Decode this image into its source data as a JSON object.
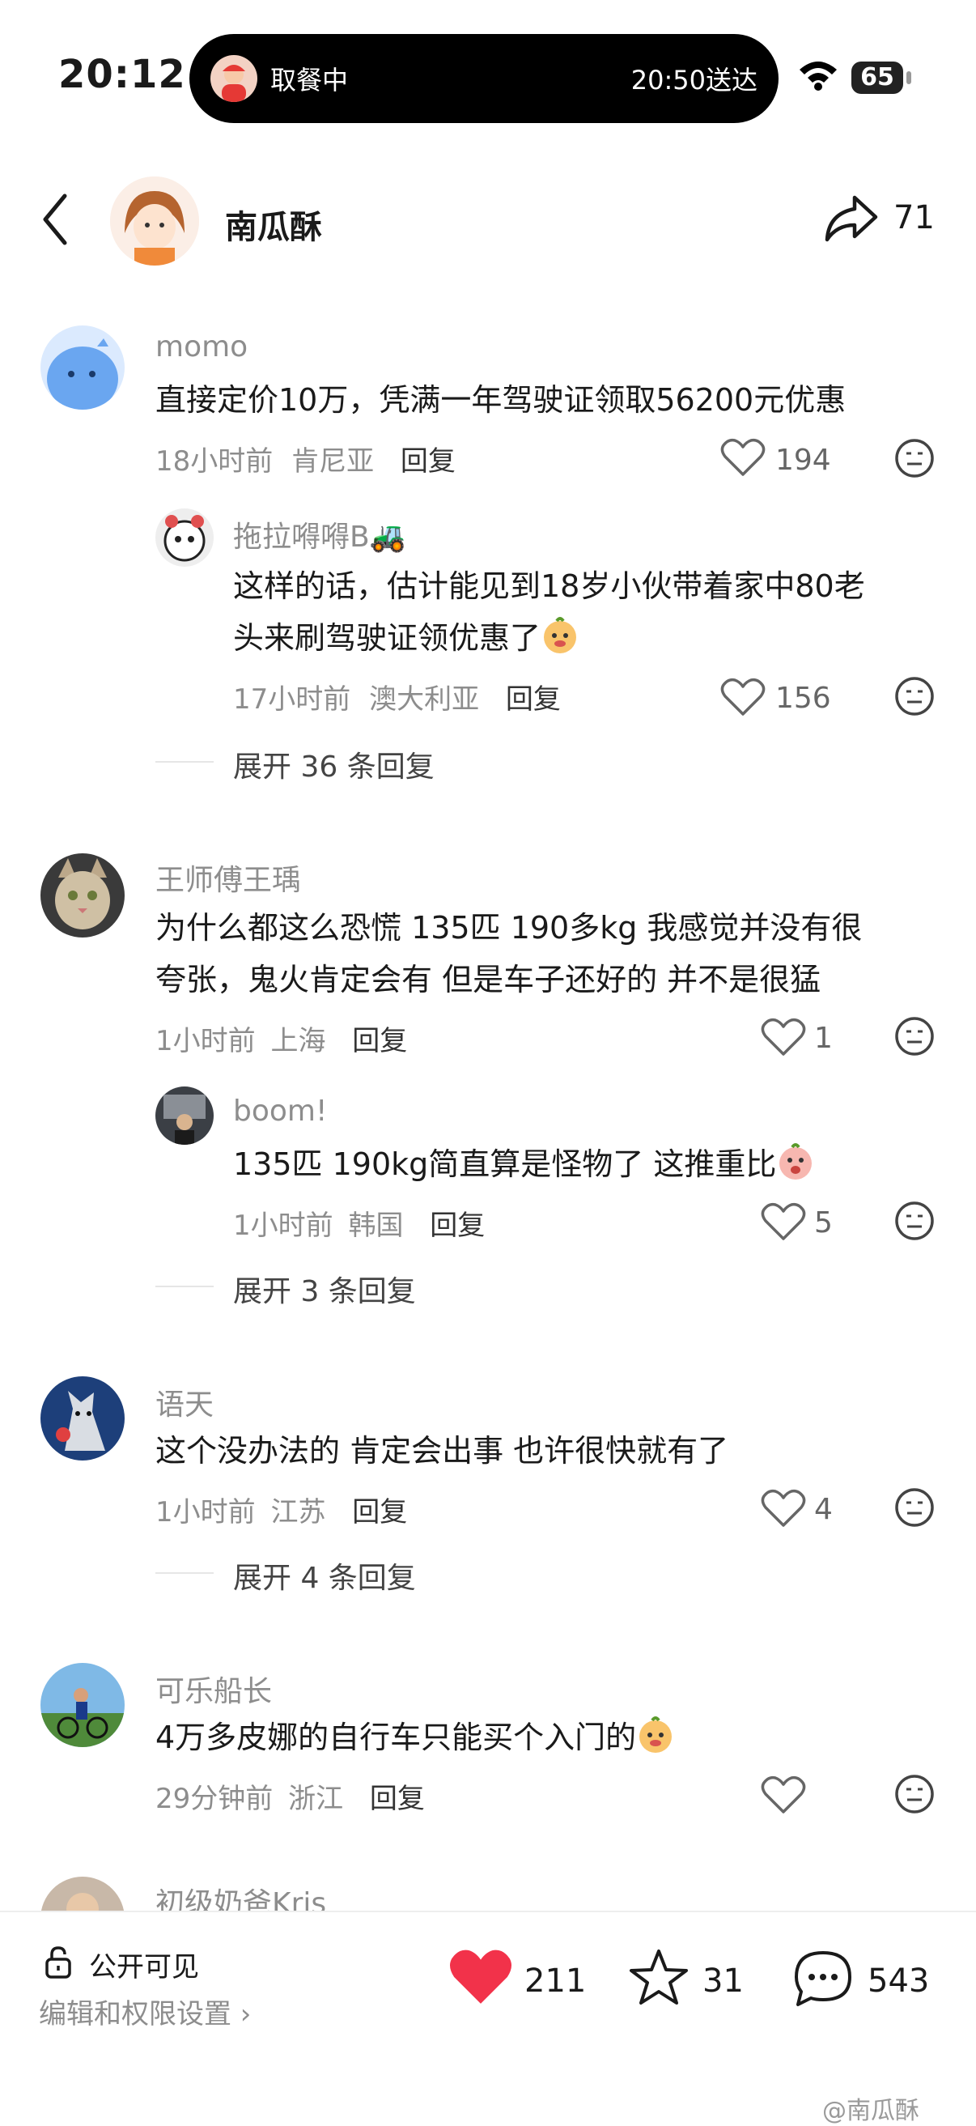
{
  "status": {
    "time": "20:12",
    "island_left": "取餐中",
    "island_right": "20:50送达",
    "battery": "65"
  },
  "header": {
    "name": "南瓜酥",
    "share_count": "71"
  },
  "comments": [
    {
      "user": "momo",
      "text": "直接定价10万，凭满一年驾驶证领取56200元优惠",
      "time": "18小时前",
      "location": "肯尼亚",
      "reply": "回复",
      "likes": "194",
      "replies": [
        {
          "user": "拖拉嘚嘚B🚜",
          "text1": "这样的话，估计能见到18岁小伙带着家中80老",
          "text2": "头来刷驾驶证领优惠了",
          "time": "17小时前",
          "location": "澳大利亚",
          "reply": "回复",
          "likes": "156"
        }
      ],
      "expand": "展开 36 条回复"
    },
    {
      "user": "王师傅王瑀",
      "text1": "为什么都这么恐慌 135匹 190多kg 我感觉并没有很",
      "text2": "夸张，鬼火肯定会有 但是车子还好的 并不是很猛",
      "time": "1小时前",
      "location": "上海",
      "reply": "回复",
      "likes": "1",
      "replies": [
        {
          "user": "boom!",
          "text": "135匹 190kg简直算是怪物了 这推重比",
          "time": "1小时前",
          "location": "韩国",
          "reply": "回复",
          "likes": "5"
        }
      ],
      "expand": "展开 3 条回复"
    },
    {
      "user": "语天",
      "text": "这个没办法的 肯定会出事 也许很快就有了",
      "time": "1小时前",
      "location": "江苏",
      "reply": "回复",
      "likes": "4",
      "expand": "展开 4 条回复"
    },
    {
      "user": "可乐船长",
      "text": "4万多皮娜的自行车只能买个入门的",
      "time": "29分钟前",
      "location": "浙江",
      "reply": "回复"
    },
    {
      "user": "初级奶爸Kris"
    }
  ],
  "bottom": {
    "visibility": "公开可见",
    "settings": "编辑和权限设置 ›",
    "likes": "211",
    "stars": "31",
    "comments": "543"
  },
  "watermark": "@南瓜酥"
}
